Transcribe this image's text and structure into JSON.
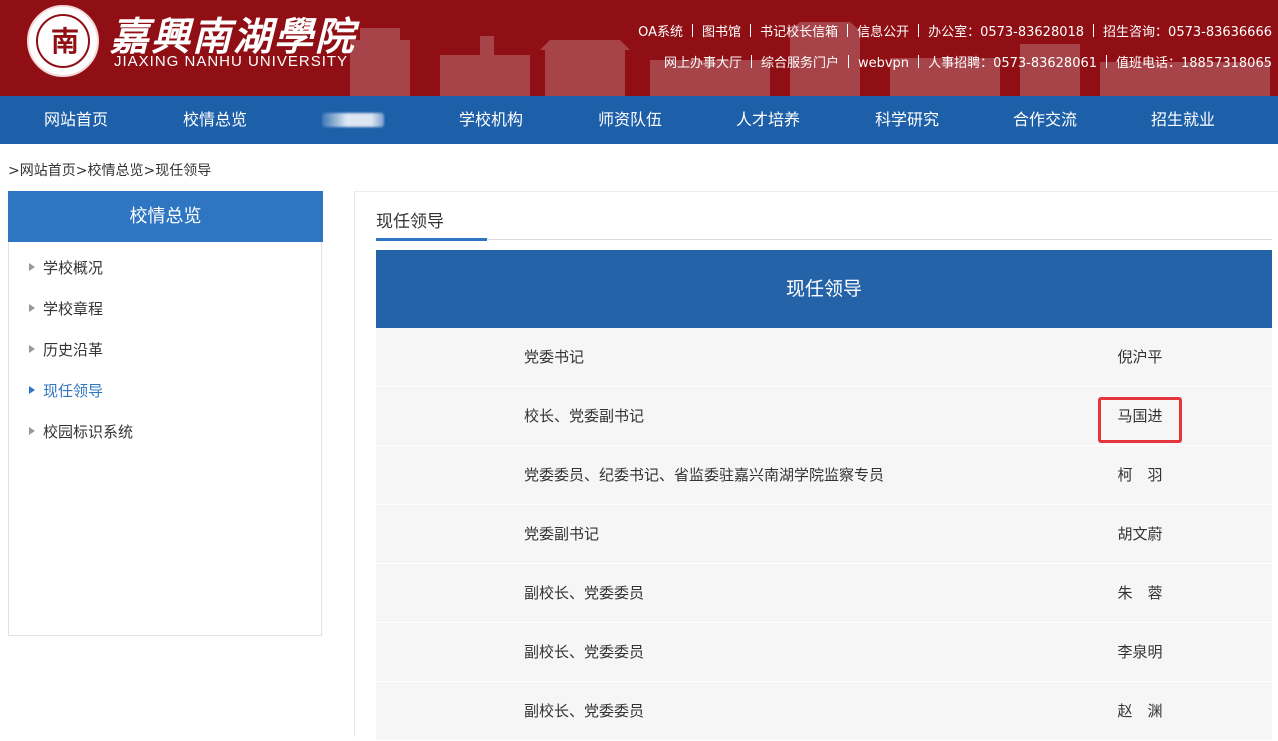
{
  "header": {
    "school_name_cn": "嘉興南湖學院",
    "school_name_en": "JIAXING NANHU UNIVERSITY",
    "seal_glyph": "南",
    "links_row1": [
      "OA系统",
      "图书馆",
      "书记校长信箱",
      "信息公开",
      "办公室：0573-83628018",
      "招生咨询：0573-83636666"
    ],
    "links_row2": [
      "网上办事大厅",
      "综合服务门户",
      "webvpn",
      "人事招聘：0573-83628061",
      "值班电话：18857318065"
    ]
  },
  "nav": {
    "items": [
      "网站首页",
      "校情总览",
      "",
      "学校机构",
      "师资队伍",
      "人才培养",
      "科学研究",
      "合作交流",
      "招生就业"
    ]
  },
  "breadcrumb": [
    ">网站首页",
    ">校情总览",
    ">现任领导"
  ],
  "sidebar": {
    "title": "校情总览",
    "items": [
      "学校概况",
      "学校章程",
      "历史沿革",
      "现任领导",
      "校园标识系统"
    ],
    "active_index": 3
  },
  "main": {
    "title": "现任领导",
    "table_title": "现任领导",
    "rows": [
      {
        "position": "党委书记",
        "name": "倪沪平"
      },
      {
        "position": "校长、党委副书记",
        "name": "马国进",
        "highlighted": true
      },
      {
        "position": "党委委员、纪委书记、省监委驻嘉兴南湖学院监察专员",
        "name": "柯　羽"
      },
      {
        "position": "党委副书记",
        "name": "胡文蔚"
      },
      {
        "position": "副校长、党委委员",
        "name": "朱　蓉"
      },
      {
        "position": "副校长、党委委员",
        "name": "李泉明"
      },
      {
        "position": "副校长、党委委员",
        "name": "赵　渊"
      }
    ]
  },
  "colors": {
    "header_red": "#8f0f15",
    "nav_blue": "#1d5fa8",
    "sidebar_blue": "#2f76c2",
    "table_head_blue": "#2563a8",
    "highlight_red": "#e4363b"
  }
}
